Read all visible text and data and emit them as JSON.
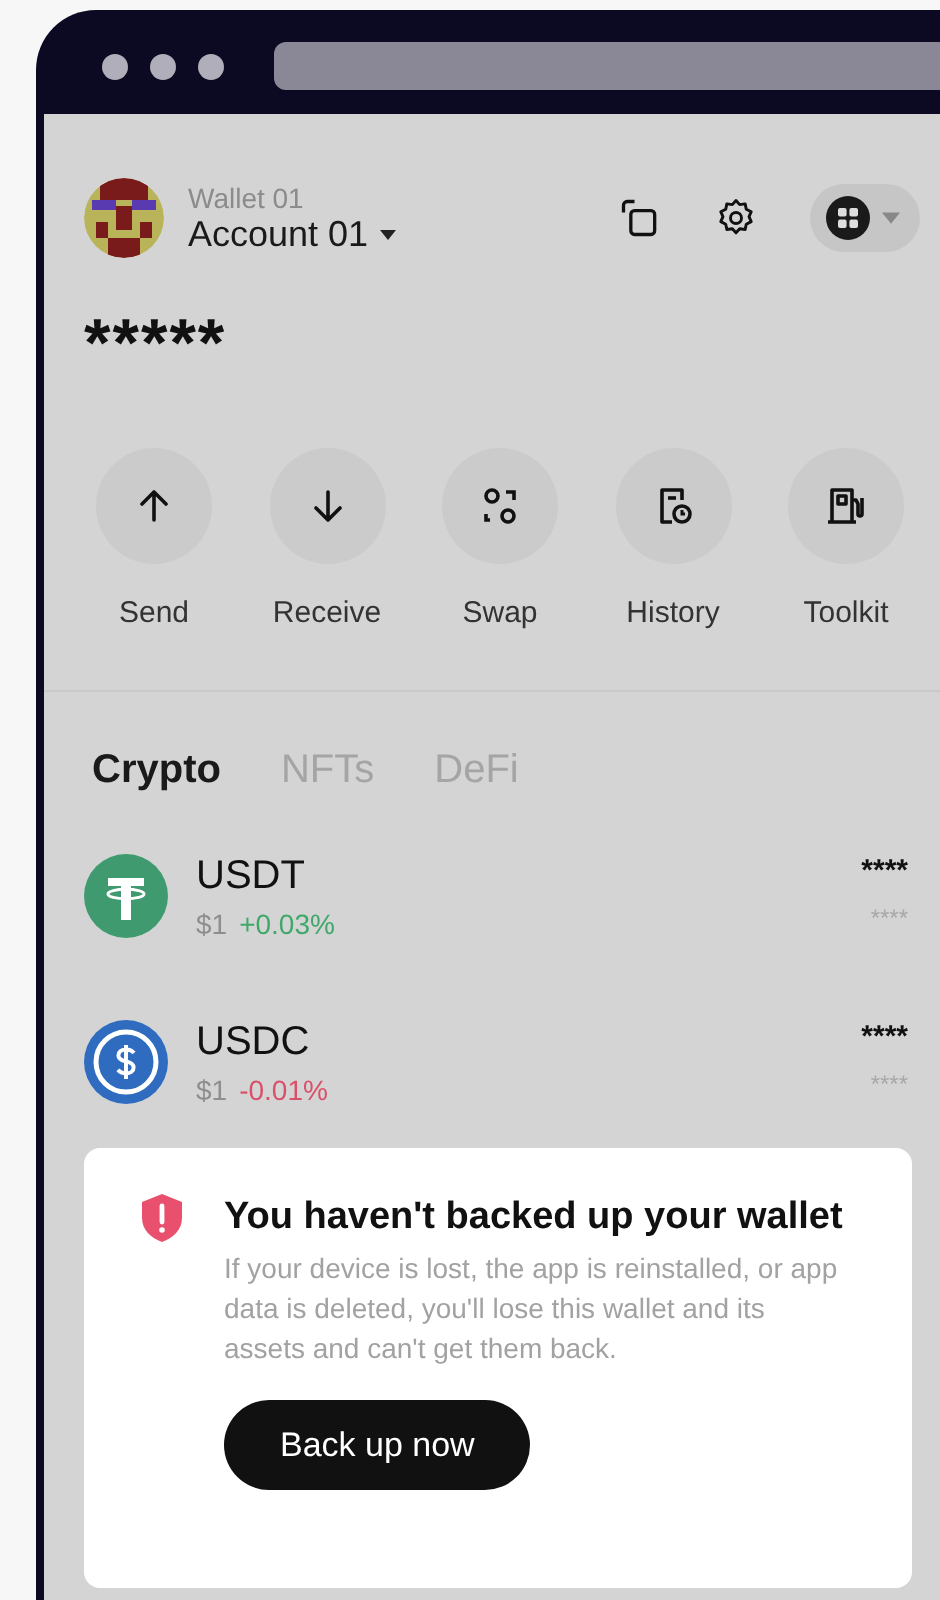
{
  "header": {
    "wallet_name": "Wallet 01",
    "account_name": "Account 01"
  },
  "balance": "*****",
  "actions": [
    {
      "kind": "send",
      "label": "Send"
    },
    {
      "kind": "receive",
      "label": "Receive"
    },
    {
      "kind": "swap",
      "label": "Swap"
    },
    {
      "kind": "history",
      "label": "History"
    },
    {
      "kind": "toolkit",
      "label": "Toolkit"
    }
  ],
  "tabs": [
    {
      "label": "Crypto",
      "selected": true
    },
    {
      "label": "NFTs",
      "selected": false
    },
    {
      "label": "DeFi",
      "selected": false
    }
  ],
  "assets": [
    {
      "kind": "usdt",
      "symbol": "USDT",
      "price": "$1",
      "change": "+0.03%",
      "color": "#3fa86a",
      "amount": "****",
      "value": "****"
    },
    {
      "kind": "usdc",
      "symbol": "USDC",
      "price": "$1",
      "change": "-0.01%",
      "color": "#d9506a",
      "amount": "****",
      "value": "****"
    }
  ],
  "backup_prompt": {
    "title": "You haven't backed up your wallet",
    "message": "If your device is lost, the app is reinstalled, or app data is deleted, you'll lose this wallet and its assets and can't get them back.",
    "button": "Back up now"
  }
}
